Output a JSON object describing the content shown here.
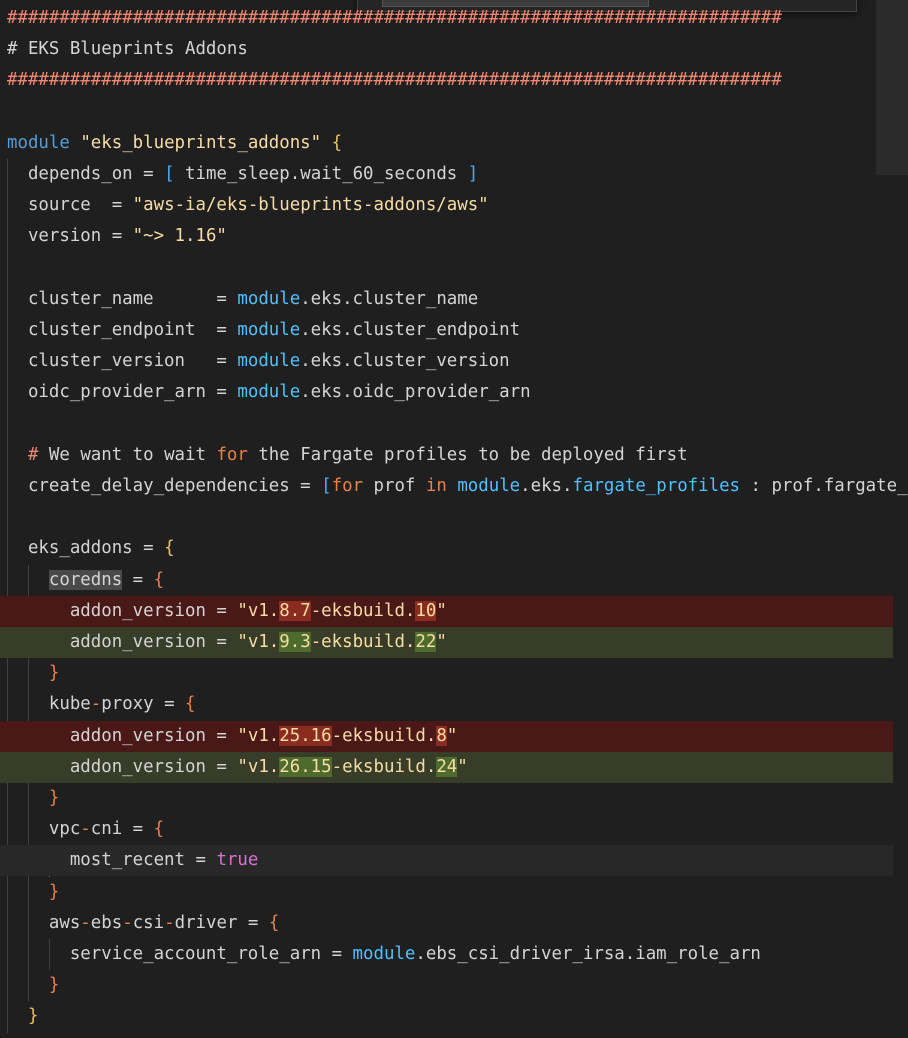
{
  "colors": {
    "background": "#1f1f1f",
    "default_text": "#d4d4d4",
    "comment": "#ce9178",
    "string": "#ce9178",
    "keyword": "#c586c0",
    "module_ref": "#4ec9b0",
    "bracket": "#ffd700",
    "removed_line": "#4b1818",
    "added_line": "#373d29"
  },
  "editor": {
    "lines": [
      {
        "tokens": [
          {
            "t": "##########################################################################",
            "c": "#f48771"
          }
        ]
      },
      {
        "tokens": [
          {
            "t": "# EKS Blueprints Addons",
            "c": "#d4d4d4"
          }
        ]
      },
      {
        "tokens": [
          {
            "t": "##########################################################################",
            "c": "#f48771"
          }
        ]
      },
      {
        "tokens": []
      },
      {
        "tokens": [
          {
            "t": "module",
            "c": "#569cd6"
          },
          {
            "t": " ",
            "c": "#d4d4d4"
          },
          {
            "t": "\"eks_blueprints_addons\"",
            "c": "#f9dca4"
          },
          {
            "t": " ",
            "c": "#d4d4d4"
          },
          {
            "t": "{",
            "c": "#e8c26a"
          }
        ]
      },
      {
        "tokens": [
          {
            "t": "  depends_on ",
            "c": "#d4d4d4"
          },
          {
            "t": "=",
            "c": "#d4d4d4"
          },
          {
            "t": " ",
            "c": "#d4d4d4"
          },
          {
            "t": "[",
            "c": "#4aa8f0"
          },
          {
            "t": " time_sleep.wait_60_seconds ",
            "c": "#d4d4d4"
          },
          {
            "t": "]",
            "c": "#4aa8f0"
          }
        ]
      },
      {
        "tokens": [
          {
            "t": "  source  ",
            "c": "#d4d4d4"
          },
          {
            "t": "=",
            "c": "#d4d4d4"
          },
          {
            "t": " ",
            "c": "#d4d4d4"
          },
          {
            "t": "\"aws-ia/eks-blueprints-addons/aws\"",
            "c": "#f9dca4"
          }
        ]
      },
      {
        "tokens": [
          {
            "t": "  version ",
            "c": "#d4d4d4"
          },
          {
            "t": "=",
            "c": "#d4d4d4"
          },
          {
            "t": " ",
            "c": "#d4d4d4"
          },
          {
            "t": "\"~> 1.16\"",
            "c": "#f9dca4"
          }
        ]
      },
      {
        "tokens": []
      },
      {
        "tokens": [
          {
            "t": "  cluster_name      ",
            "c": "#d4d4d4"
          },
          {
            "t": "=",
            "c": "#d4d4d4"
          },
          {
            "t": " ",
            "c": "#d4d4d4"
          },
          {
            "t": "module",
            "c": "#4fc1ff"
          },
          {
            "t": ".eks.cluster_name",
            "c": "#d4d4d4"
          }
        ]
      },
      {
        "tokens": [
          {
            "t": "  cluster_endpoint  ",
            "c": "#d4d4d4"
          },
          {
            "t": "=",
            "c": "#d4d4d4"
          },
          {
            "t": " ",
            "c": "#d4d4d4"
          },
          {
            "t": "module",
            "c": "#4fc1ff"
          },
          {
            "t": ".eks.cluster_endpoint",
            "c": "#d4d4d4"
          }
        ]
      },
      {
        "tokens": [
          {
            "t": "  cluster_version   ",
            "c": "#d4d4d4"
          },
          {
            "t": "=",
            "c": "#d4d4d4"
          },
          {
            "t": " ",
            "c": "#d4d4d4"
          },
          {
            "t": "module",
            "c": "#4fc1ff"
          },
          {
            "t": ".eks.cluster_version",
            "c": "#d4d4d4"
          }
        ]
      },
      {
        "tokens": [
          {
            "t": "  oidc_provider_arn ",
            "c": "#d4d4d4"
          },
          {
            "t": "=",
            "c": "#d4d4d4"
          },
          {
            "t": " ",
            "c": "#d4d4d4"
          },
          {
            "t": "module",
            "c": "#4fc1ff"
          },
          {
            "t": ".eks.oidc_provider_arn",
            "c": "#d4d4d4"
          }
        ]
      },
      {
        "tokens": []
      },
      {
        "tokens": [
          {
            "t": "  ",
            "c": "#d4d4d4"
          },
          {
            "t": "#",
            "c": "#f48771"
          },
          {
            "t": " We want to wait ",
            "c": "#d4d4d4"
          },
          {
            "t": "for",
            "c": "#e8814a"
          },
          {
            "t": " the Fargate profiles to be deployed first",
            "c": "#d4d4d4"
          }
        ]
      },
      {
        "tokens": [
          {
            "t": "  create_delay_dependencies ",
            "c": "#d4d4d4"
          },
          {
            "t": "=",
            "c": "#d4d4d4"
          },
          {
            "t": " ",
            "c": "#d4d4d4"
          },
          {
            "t": "[",
            "c": "#4aa8f0"
          },
          {
            "t": "for",
            "c": "#e8814a"
          },
          {
            "t": " prof ",
            "c": "#d4d4d4"
          },
          {
            "t": "in",
            "c": "#e8814a"
          },
          {
            "t": " ",
            "c": "#d4d4d4"
          },
          {
            "t": "module",
            "c": "#4fc1ff"
          },
          {
            "t": ".eks.",
            "c": "#d4d4d4"
          },
          {
            "t": "fargate_profiles",
            "c": "#4fc1ff"
          },
          {
            "t": " : prof.fargate_p",
            "c": "#d4d4d4"
          }
        ]
      },
      {
        "tokens": []
      },
      {
        "tokens": [
          {
            "t": "  eks_addons ",
            "c": "#d4d4d4"
          },
          {
            "t": "=",
            "c": "#d4d4d4"
          },
          {
            "t": " ",
            "c": "#d4d4d4"
          },
          {
            "t": "{",
            "c": "#e8c26a"
          }
        ]
      },
      {
        "tokens": [
          {
            "t": "    ",
            "c": "#d4d4d4"
          },
          {
            "t": "coredns",
            "c": "#d4d4d4",
            "h": "word"
          },
          {
            "t": " ",
            "c": "#d4d4d4"
          },
          {
            "t": "=",
            "c": "#d4d4d4"
          },
          {
            "t": " ",
            "c": "#d4d4d4"
          },
          {
            "t": "{",
            "c": "#e8814a"
          }
        ]
      },
      {
        "kind": "removed",
        "tokens": [
          {
            "t": "      addon_version ",
            "c": "#d4d4d4"
          },
          {
            "t": "=",
            "c": "#d4d4d4"
          },
          {
            "t": " ",
            "c": "#d4d4d4"
          },
          {
            "t": "\"v1.",
            "c": "#f9dca4"
          },
          {
            "t": "8.7",
            "c": "#f9dca4",
            "h": "removed"
          },
          {
            "t": "-eksbuild.",
            "c": "#f9dca4"
          },
          {
            "t": "10",
            "c": "#f9dca4",
            "h": "removed"
          },
          {
            "t": "\"",
            "c": "#f9dca4"
          }
        ]
      },
      {
        "kind": "added",
        "tokens": [
          {
            "t": "      addon_version ",
            "c": "#d4d4d4"
          },
          {
            "t": "=",
            "c": "#d4d4d4"
          },
          {
            "t": " ",
            "c": "#d4d4d4"
          },
          {
            "t": "\"v1.",
            "c": "#f9dca4"
          },
          {
            "t": "9.3",
            "c": "#f9dca4",
            "h": "added"
          },
          {
            "t": "-eksbuild.",
            "c": "#f9dca4"
          },
          {
            "t": "22",
            "c": "#f9dca4",
            "h": "added"
          },
          {
            "t": "\"",
            "c": "#f9dca4"
          }
        ]
      },
      {
        "tokens": [
          {
            "t": "    ",
            "c": "#d4d4d4"
          },
          {
            "t": "}",
            "c": "#e8814a"
          }
        ]
      },
      {
        "tokens": [
          {
            "t": "    kube",
            "c": "#d4d4d4"
          },
          {
            "t": "-",
            "c": "#e8814a"
          },
          {
            "t": "proxy ",
            "c": "#d4d4d4"
          },
          {
            "t": "=",
            "c": "#d4d4d4"
          },
          {
            "t": " ",
            "c": "#d4d4d4"
          },
          {
            "t": "{",
            "c": "#e8814a"
          }
        ]
      },
      {
        "kind": "removed",
        "tokens": [
          {
            "t": "      addon_version ",
            "c": "#d4d4d4"
          },
          {
            "t": "=",
            "c": "#d4d4d4"
          },
          {
            "t": " ",
            "c": "#d4d4d4"
          },
          {
            "t": "\"v1.",
            "c": "#f9dca4"
          },
          {
            "t": "25.16",
            "c": "#f9dca4",
            "h": "removed"
          },
          {
            "t": "-eksbuild.",
            "c": "#f9dca4"
          },
          {
            "t": "8",
            "c": "#f9dca4",
            "h": "removed"
          },
          {
            "t": "\"",
            "c": "#f9dca4"
          }
        ]
      },
      {
        "kind": "added",
        "tokens": [
          {
            "t": "      addon_version ",
            "c": "#d4d4d4"
          },
          {
            "t": "=",
            "c": "#d4d4d4"
          },
          {
            "t": " ",
            "c": "#d4d4d4"
          },
          {
            "t": "\"v1.",
            "c": "#f9dca4"
          },
          {
            "t": "26.15",
            "c": "#f9dca4",
            "h": "added"
          },
          {
            "t": "-eksbuild.",
            "c": "#f9dca4"
          },
          {
            "t": "24",
            "c": "#f9dca4",
            "h": "added"
          },
          {
            "t": "\"",
            "c": "#f9dca4"
          }
        ]
      },
      {
        "tokens": [
          {
            "t": "    ",
            "c": "#d4d4d4"
          },
          {
            "t": "}",
            "c": "#e8814a"
          }
        ]
      },
      {
        "tokens": [
          {
            "t": "    vpc",
            "c": "#d4d4d4"
          },
          {
            "t": "-",
            "c": "#e8814a"
          },
          {
            "t": "cni ",
            "c": "#d4d4d4"
          },
          {
            "t": "=",
            "c": "#d4d4d4"
          },
          {
            "t": " ",
            "c": "#d4d4d4"
          },
          {
            "t": "{",
            "c": "#e8814a"
          }
        ]
      },
      {
        "kind": "current",
        "tokens": [
          {
            "t": "      most_recent ",
            "c": "#d4d4d4"
          },
          {
            "t": "=",
            "c": "#d4d4d4"
          },
          {
            "t": " ",
            "c": "#d4d4d4"
          },
          {
            "t": "true",
            "c": "#d670d6"
          }
        ]
      },
      {
        "tokens": [
          {
            "t": "    ",
            "c": "#d4d4d4"
          },
          {
            "t": "}",
            "c": "#e8814a"
          }
        ]
      },
      {
        "tokens": [
          {
            "t": "    aws",
            "c": "#d4d4d4"
          },
          {
            "t": "-",
            "c": "#e8814a"
          },
          {
            "t": "ebs",
            "c": "#d4d4d4"
          },
          {
            "t": "-",
            "c": "#e8814a"
          },
          {
            "t": "csi",
            "c": "#d4d4d4"
          },
          {
            "t": "-",
            "c": "#e8814a"
          },
          {
            "t": "driver ",
            "c": "#d4d4d4"
          },
          {
            "t": "=",
            "c": "#d4d4d4"
          },
          {
            "t": " ",
            "c": "#d4d4d4"
          },
          {
            "t": "{",
            "c": "#e8814a"
          }
        ]
      },
      {
        "tokens": [
          {
            "t": "      service_account_role_arn ",
            "c": "#d4d4d4"
          },
          {
            "t": "=",
            "c": "#d4d4d4"
          },
          {
            "t": " ",
            "c": "#d4d4d4"
          },
          {
            "t": "module",
            "c": "#4fc1ff"
          },
          {
            "t": ".ebs_csi_driver_irsa.iam_role_arn",
            "c": "#d4d4d4"
          }
        ]
      },
      {
        "tokens": [
          {
            "t": "    ",
            "c": "#d4d4d4"
          },
          {
            "t": "}",
            "c": "#e8814a"
          }
        ]
      },
      {
        "tokens": [
          {
            "t": "  ",
            "c": "#d4d4d4"
          },
          {
            "t": "}",
            "c": "#e8c26a"
          }
        ]
      }
    ]
  }
}
